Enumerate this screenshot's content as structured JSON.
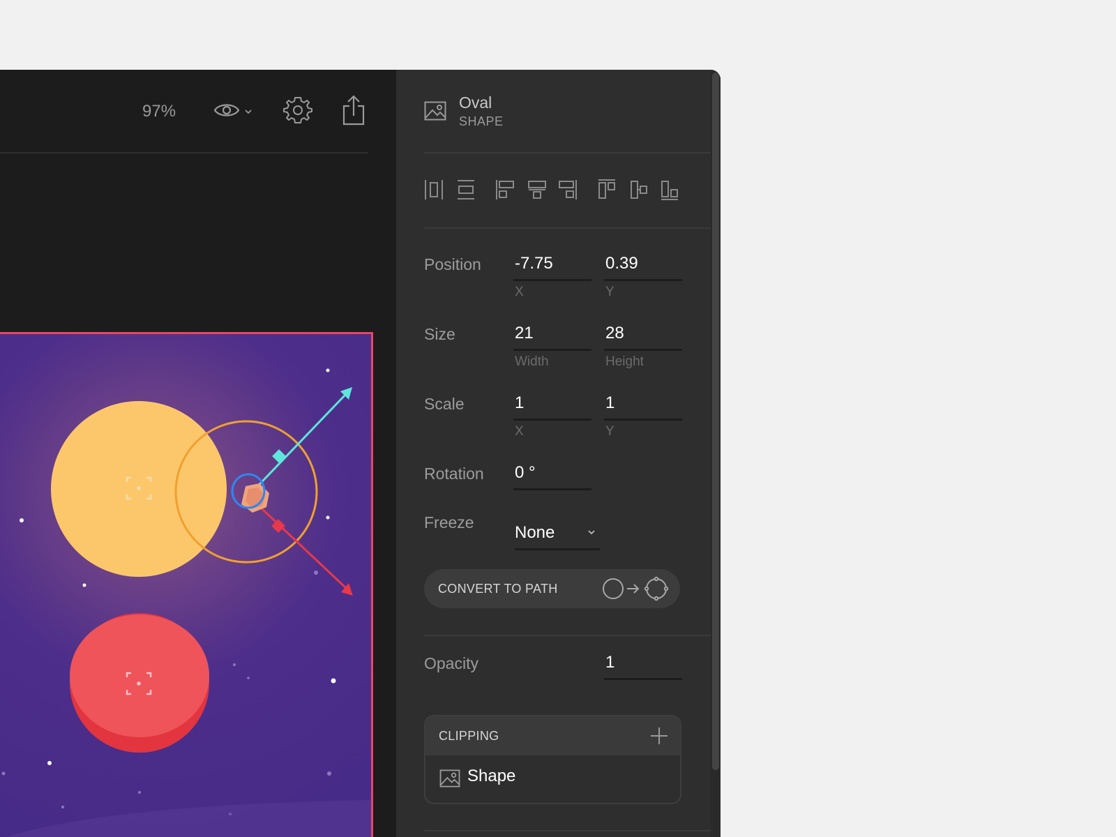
{
  "toolbar": {
    "zoom": "97%",
    "preview_icon": "eye-icon",
    "settings_icon": "gear-icon",
    "export_icon": "share-icon"
  },
  "inspector": {
    "object_name": "Oval",
    "object_type": "SHAPE",
    "object_icon": "image-icon",
    "align_icons": [
      "distribute-horizontal-icon",
      "distribute-vertical-icon",
      "align-left-icon",
      "align-center-horizontal-icon",
      "align-right-icon",
      "align-top-icon",
      "align-center-vertical-icon",
      "align-bottom-icon"
    ],
    "position": {
      "label": "Position",
      "x": "-7.75",
      "y": "0.39",
      "x_label": "X",
      "y_label": "Y"
    },
    "size": {
      "label": "Size",
      "width": "21",
      "height": "28",
      "width_label": "Width",
      "height_label": "Height"
    },
    "scale": {
      "label": "Scale",
      "x": "1",
      "y": "1",
      "x_label": "X",
      "y_label": "Y"
    },
    "rotation": {
      "label": "Rotation",
      "value": "0 °"
    },
    "freeze": {
      "label": "Freeze",
      "value": "None"
    },
    "convert_button": "CONVERT TO PATH",
    "opacity": {
      "label": "Opacity",
      "value": "1"
    },
    "clipping": {
      "title": "CLIPPING",
      "add_icon": "plus-icon",
      "items": [
        {
          "label": "Shape",
          "icon": "image-icon"
        }
      ]
    }
  },
  "colors": {
    "accent_frame": "#e8456a",
    "canvas_bg": "#452a87",
    "sun": "#fcc76b",
    "planet": "#ee545a",
    "orbit": "#f0a030",
    "handle_cyan": "#5ee6dc",
    "handle_red": "#e8384a",
    "selection_blue": "#2f86f0"
  }
}
